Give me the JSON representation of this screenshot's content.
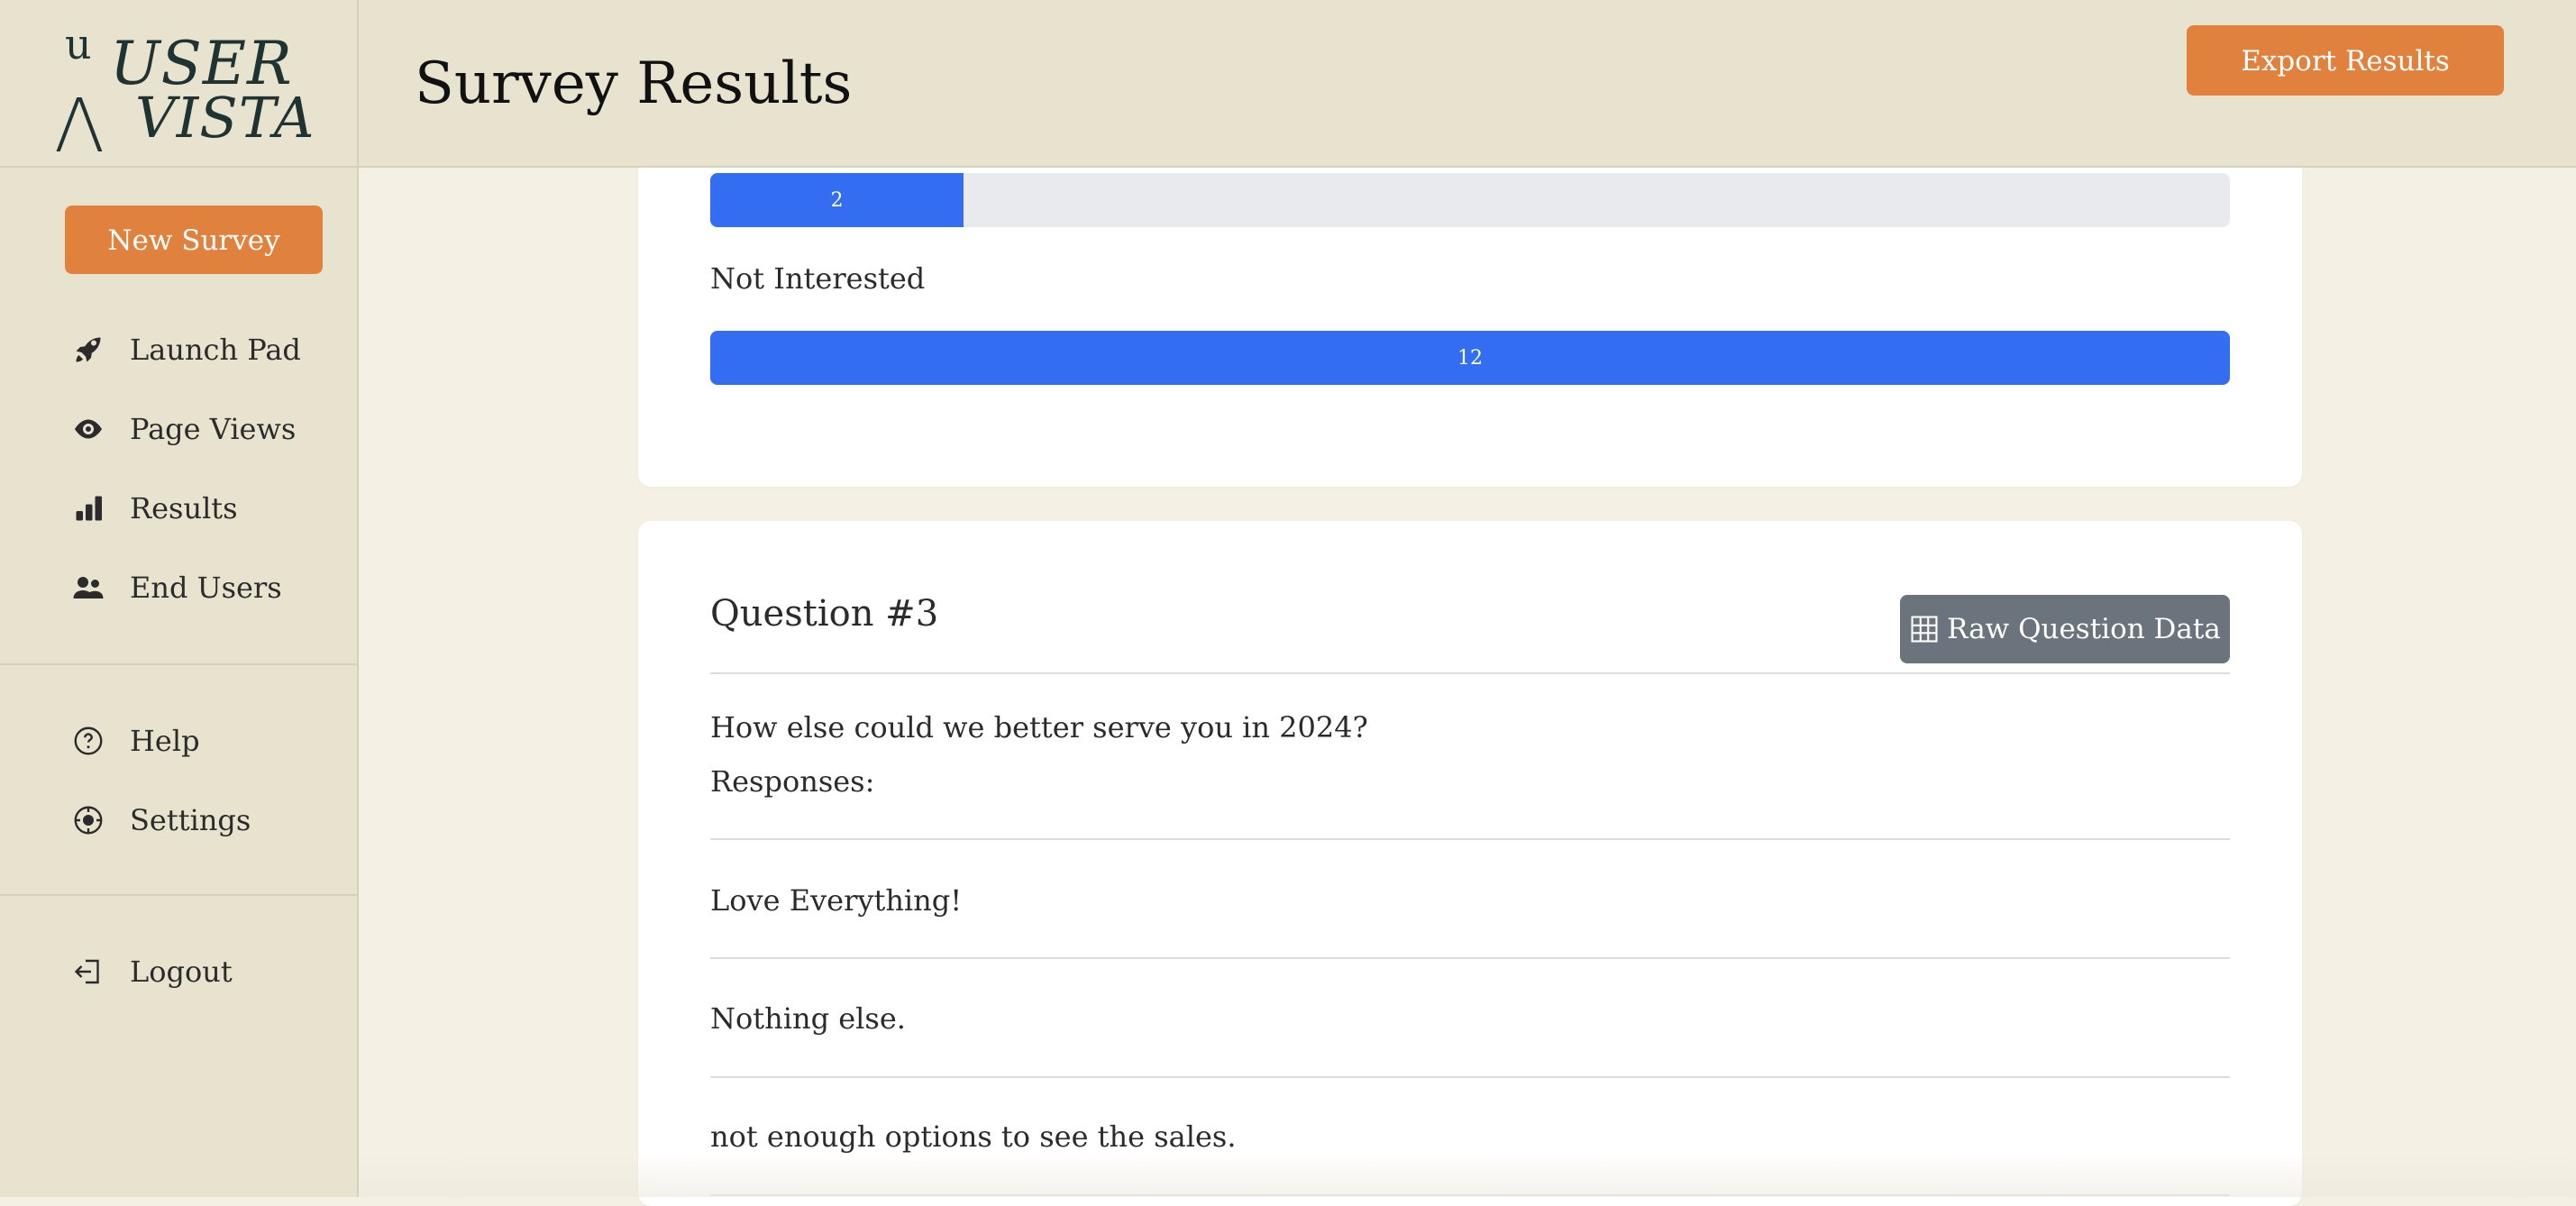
{
  "brand": {
    "mark_top": "u",
    "mark_bottom": "Λ",
    "word1": "USER",
    "word2": "VISTA"
  },
  "sidebar": {
    "new_survey_label": "New Survey",
    "nav": [
      {
        "label": "Launch Pad",
        "icon": "rocket-icon"
      },
      {
        "label": "Page Views",
        "icon": "eye-icon"
      },
      {
        "label": "Results",
        "icon": "bar-chart-icon"
      },
      {
        "label": "End Users",
        "icon": "users-icon"
      }
    ],
    "secondary": [
      {
        "label": "Help",
        "icon": "question-circle-icon"
      },
      {
        "label": "Settings",
        "icon": "settings-icon"
      }
    ],
    "logout_label": "Logout"
  },
  "header": {
    "title": "Survey Results",
    "export_label": "Export Results"
  },
  "question2": {
    "options": [
      {
        "label": "",
        "count": "2",
        "fraction": 0.1667
      },
      {
        "label": "Not Interested",
        "count": "12",
        "fraction": 1.0
      }
    ]
  },
  "question3": {
    "title": "Question #3",
    "raw_button_label": "Raw Question Data",
    "prompt": "How else could we better serve you in 2024?",
    "responses_label": "Responses:",
    "responses": [
      "Love Everything!",
      "Nothing else.",
      "not enough options to see the sales."
    ]
  },
  "colors": {
    "accent": "#e0823d",
    "bar": "#336ef2",
    "sidebar_bg": "#e8e3cf",
    "secondary_button": "#6b737c"
  }
}
